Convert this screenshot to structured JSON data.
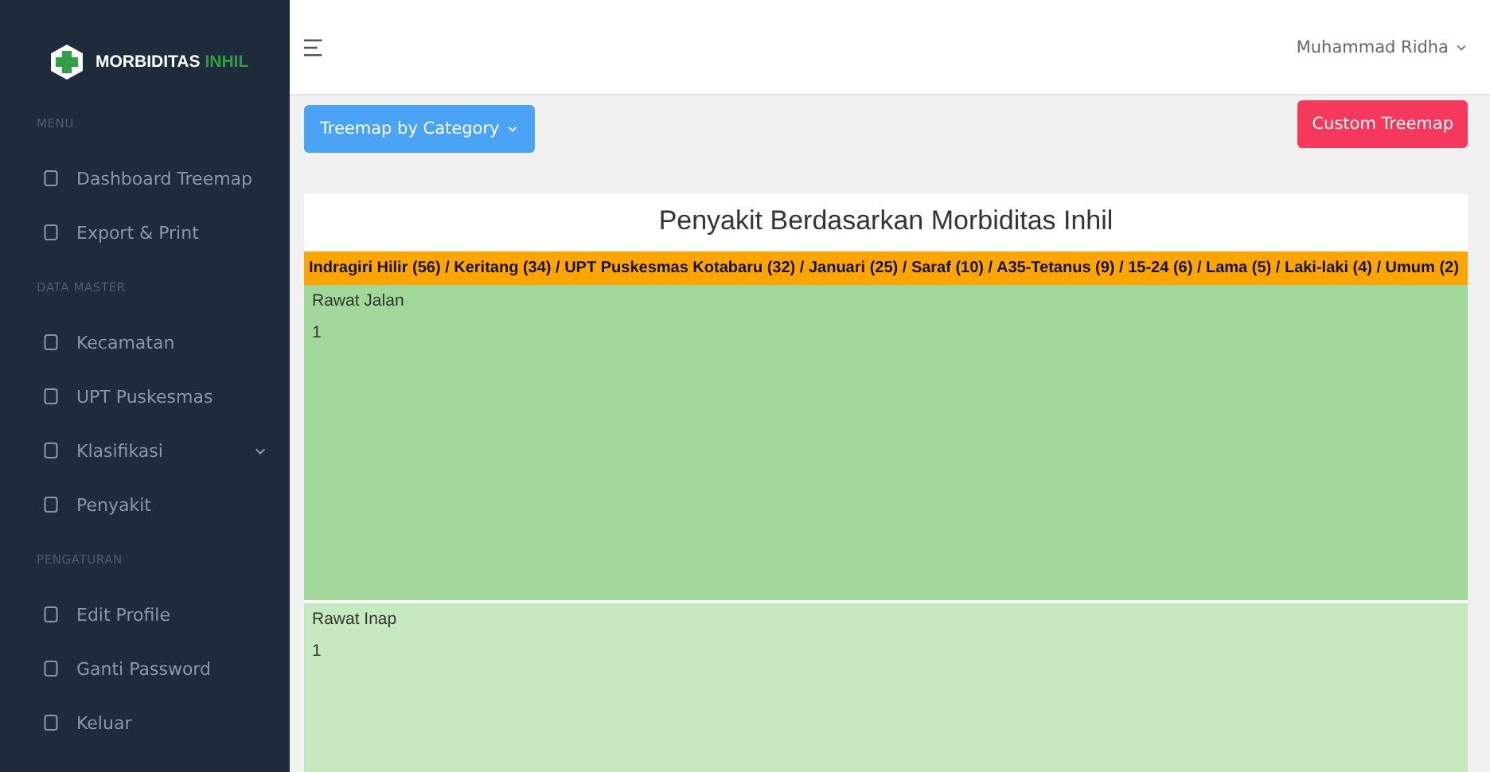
{
  "logo": {
    "text_1": "MORBIDITAS",
    "text_2": "INHIL"
  },
  "sidebar": {
    "items": [
      {
        "kind": "section",
        "label": "MENU"
      },
      {
        "kind": "item",
        "label": "Dashboard Treemap"
      },
      {
        "kind": "item",
        "label": "Export & Print"
      },
      {
        "kind": "section",
        "label": "DATA MASTER"
      },
      {
        "kind": "item",
        "label": "Kecamatan"
      },
      {
        "kind": "item",
        "label": "UPT Puskesmas"
      },
      {
        "kind": "item",
        "label": "Klasifikasi",
        "expanded": false
      },
      {
        "kind": "item",
        "label": "Penyakit"
      },
      {
        "kind": "section",
        "label": "PENGATURAN"
      },
      {
        "kind": "item",
        "label": "Edit Profile"
      },
      {
        "kind": "item",
        "label": "Ganti Password"
      },
      {
        "kind": "item",
        "label": "Keluar"
      }
    ]
  },
  "header": {
    "user": "Muhammad Ridha"
  },
  "toolbar": {
    "dropdown": "Treemap by Category",
    "button": "Custom Treemap"
  },
  "treemap": {
    "title": "Penyakit Berdasarkan Morbiditas Inhil",
    "breadcrumb": "Indragiri Hilir (56) / Keritang (34) / UPT Puskesmas Kotabaru (32) / Januari (25) / Saraf (10) / A35-Tetanus (9) / 15-24 (6) / Lama (5) / Laki-laki (4) / Umum (2)",
    "cells": [
      {
        "label": "Rawat Jalan",
        "value": "1",
        "color": "#a1d99b"
      },
      {
        "label": "Rawat Inap",
        "value": "1",
        "color": "#c7e9c0"
      }
    ]
  }
}
